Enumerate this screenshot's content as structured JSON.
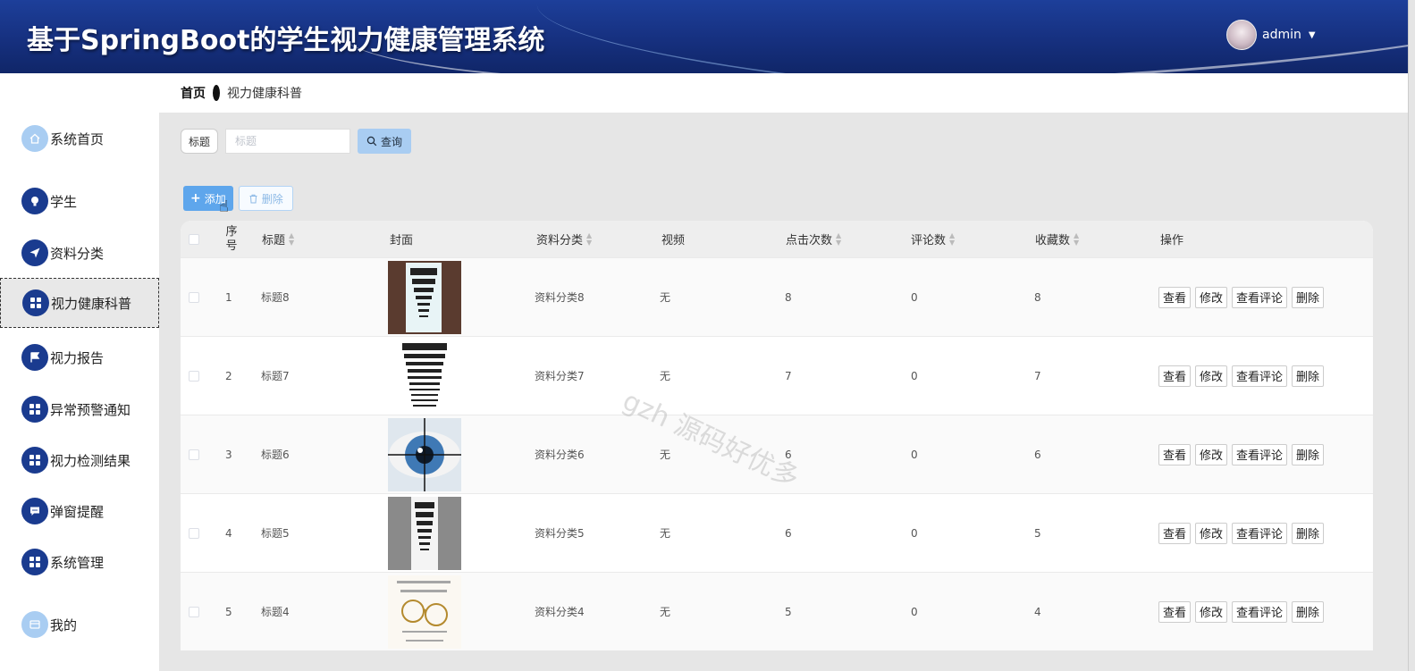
{
  "header": {
    "title": "基于SpringBoot的学生视力健康管理系统",
    "username": "admin"
  },
  "sidebar": {
    "items": [
      {
        "label": "系统首页",
        "icon": "home-icon"
      },
      {
        "label": "学生",
        "icon": "bulb-icon"
      },
      {
        "label": "资料分类",
        "icon": "send-icon"
      },
      {
        "label": "视力健康科普",
        "icon": "grid-icon",
        "active": true
      },
      {
        "label": "视力报告",
        "icon": "flag-icon"
      },
      {
        "label": "异常预警通知",
        "icon": "grid-icon"
      },
      {
        "label": "视力检测结果",
        "icon": "grid-icon"
      },
      {
        "label": "弹窗提醒",
        "icon": "message-icon"
      },
      {
        "label": "系统管理",
        "icon": "grid-icon"
      },
      {
        "label": "我的",
        "icon": "card-icon"
      }
    ]
  },
  "breadcrumb": {
    "home": "首页",
    "current": "视力健康科普"
  },
  "search": {
    "label": "标题",
    "placeholder": "标题",
    "value": "",
    "button": "查询"
  },
  "actions": {
    "add": "添加",
    "delete": "删除"
  },
  "table": {
    "headers": {
      "index": "序号",
      "title": "标题",
      "cover": "封面",
      "category": "资料分类",
      "video": "视频",
      "clicks": "点击次数",
      "comments": "评论数",
      "favorites": "收藏数",
      "ops": "操作"
    },
    "ops": {
      "view": "查看",
      "edit": "修改",
      "view_comments": "查看评论",
      "delete": "删除"
    },
    "rows": [
      {
        "index": "1",
        "title": "标题8",
        "category": "资料分类8",
        "video": "无",
        "clicks": "8",
        "comments": "0",
        "favorites": "8"
      },
      {
        "index": "2",
        "title": "标题7",
        "category": "资料分类7",
        "video": "无",
        "clicks": "7",
        "comments": "0",
        "favorites": "7"
      },
      {
        "index": "3",
        "title": "标题6",
        "category": "资料分类6",
        "video": "无",
        "clicks": "6",
        "comments": "0",
        "favorites": "6"
      },
      {
        "index": "4",
        "title": "标题5",
        "category": "资料分类5",
        "video": "无",
        "clicks": "6",
        "comments": "0",
        "favorites": "5"
      },
      {
        "index": "5",
        "title": "标题4",
        "category": "资料分类4",
        "video": "无",
        "clicks": "5",
        "comments": "0",
        "favorites": "4"
      }
    ]
  },
  "watermark": "gzh 源码好优多",
  "colors": {
    "header": "#16307f",
    "accent": "#5ea6ec",
    "sidebar_icon": "#1a3b8f"
  }
}
